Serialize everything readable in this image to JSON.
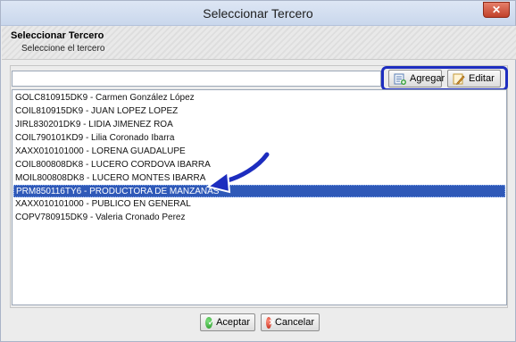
{
  "window": {
    "title": "Seleccionar Tercero",
    "close_label": "✕"
  },
  "header": {
    "title": "Seleccionar Tercero",
    "subtitle": "Seleccione el tercero"
  },
  "search": {
    "value": "",
    "placeholder": ""
  },
  "toolbar": {
    "add_label": "Agregar",
    "edit_label": "Editar"
  },
  "list": {
    "items": [
      {
        "label": "GOLC810915DK9 - Carmen González López"
      },
      {
        "label": "COIL810915DK9 - JUAN LOPEZ LOPEZ"
      },
      {
        "label": "JIRL830201DK9 - LIDIA JIMENEZ ROA"
      },
      {
        "label": "COIL790101KD9 - Lilia Coronado Ibarra"
      },
      {
        "label": "XAXX010101000 - LORENA GUADALUPE"
      },
      {
        "label": "COIL800808DK8 - LUCERO CORDOVA IBARRA"
      },
      {
        "label": "MOIL800808DK8 - LUCERO MONTES IBARRA"
      },
      {
        "label": "PRM850116TY6 - PRODUCTORA DE MANZANAS"
      },
      {
        "label": "XAXX010101000 - PUBLICO EN GENERAL"
      },
      {
        "label": "COPV780915DK9 - Valeria Cronado Perez"
      }
    ],
    "selected_index": 7
  },
  "footer": {
    "accept_label": "Aceptar",
    "cancel_label": "Cancelar"
  },
  "colors": {
    "selection": "#2f59b8",
    "highlight_border": "#1d2dbf",
    "close": "#c1412a"
  }
}
